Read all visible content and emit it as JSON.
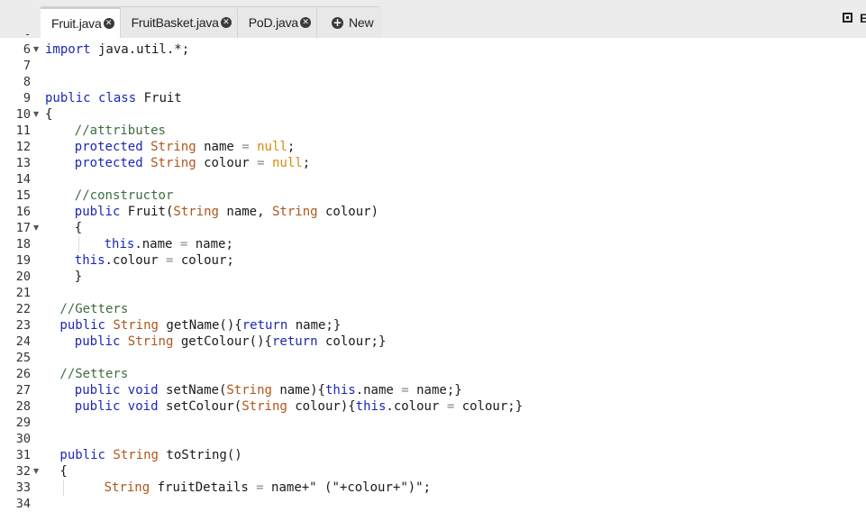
{
  "tabs": [
    {
      "label": "Fruit.java",
      "active": true
    },
    {
      "label": "FruitBasket.java",
      "active": false
    },
    {
      "label": "PoD.java",
      "active": false
    }
  ],
  "new_tab_label": "New",
  "edge_glyph": "E",
  "colors": {
    "keyword": "#1c27b8",
    "type": "#b0551b",
    "comment": "#3f6d3f",
    "literal": "#d88c0c",
    "tab_bar": "#ececec"
  },
  "editor": {
    "lines": [
      {
        "num": "6",
        "fold": true,
        "indent": 0,
        "code": [
          [
            "kw",
            "import"
          ],
          [
            "",
            "java.util.*;"
          ]
        ]
      },
      {
        "num": "7",
        "fold": false,
        "indent": 0,
        "code": []
      },
      {
        "num": "8",
        "fold": false,
        "indent": 0,
        "code": []
      },
      {
        "num": "9",
        "fold": false,
        "indent": 0,
        "code": [
          [
            "kw",
            "public class"
          ],
          [
            "",
            "Fruit"
          ]
        ]
      },
      {
        "num": "10",
        "fold": true,
        "indent": 0,
        "code": [
          [
            "",
            "{"
          ]
        ]
      },
      {
        "num": "11",
        "fold": false,
        "indent": 4,
        "code": [
          [
            "cm",
            "//attributes"
          ]
        ]
      },
      {
        "num": "12",
        "fold": false,
        "indent": 4,
        "code": [
          [
            "kw",
            "protected"
          ],
          [
            "ty",
            "String"
          ],
          [
            "",
            "name"
          ],
          [
            "op",
            "="
          ],
          [
            "nu",
            "null"
          ],
          [
            "",
            ";"
          ]
        ]
      },
      {
        "num": "13",
        "fold": false,
        "indent": 4,
        "code": [
          [
            "kw",
            "protected"
          ],
          [
            "ty",
            "String"
          ],
          [
            "",
            "colour"
          ],
          [
            "op",
            "="
          ],
          [
            "nu",
            "null"
          ],
          [
            "",
            ";"
          ]
        ]
      },
      {
        "num": "14",
        "fold": false,
        "indent": 0,
        "code": []
      },
      {
        "num": "15",
        "fold": false,
        "indent": 4,
        "code": [
          [
            "cm",
            "//constructor"
          ]
        ]
      },
      {
        "num": "16",
        "fold": false,
        "indent": 4,
        "code": [
          [
            "kw",
            "public"
          ],
          [
            "",
            "Fruit("
          ],
          [
            "ty",
            "String"
          ],
          [
            "",
            "name,"
          ],
          [
            "ty",
            "String"
          ],
          [
            "",
            "colour)"
          ]
        ]
      },
      {
        "num": "17",
        "fold": true,
        "indent": 4,
        "code": [
          [
            "",
            "{"
          ]
        ]
      },
      {
        "num": "18",
        "fold": false,
        "indent": 8,
        "code": [
          [
            "kw",
            "this"
          ],
          [
            "",
            ".name"
          ],
          [
            "op",
            "="
          ],
          [
            "",
            "name;"
          ]
        ]
      },
      {
        "num": "19",
        "fold": false,
        "indent": 4,
        "code": [
          [
            "kw",
            "this"
          ],
          [
            "",
            ".colour"
          ],
          [
            "op",
            "="
          ],
          [
            "",
            "colour;"
          ]
        ]
      },
      {
        "num": "20",
        "fold": false,
        "indent": 4,
        "code": [
          [
            "",
            "}"
          ]
        ]
      },
      {
        "num": "21",
        "fold": false,
        "indent": 0,
        "code": []
      },
      {
        "num": "22",
        "fold": false,
        "indent": 2,
        "code": [
          [
            "cm",
            "//Getters"
          ]
        ]
      },
      {
        "num": "23",
        "fold": false,
        "indent": 2,
        "code": [
          [
            "kw",
            "public"
          ],
          [
            "ty",
            "String"
          ],
          [
            "",
            "getName(){"
          ],
          [
            "kw",
            "return"
          ],
          [
            "",
            "name;}"
          ]
        ]
      },
      {
        "num": "24",
        "fold": false,
        "indent": 4,
        "code": [
          [
            "kw",
            "public"
          ],
          [
            "ty",
            "String"
          ],
          [
            "",
            "getColour(){"
          ],
          [
            "kw",
            "return"
          ],
          [
            "",
            "colour;}"
          ]
        ]
      },
      {
        "num": "25",
        "fold": false,
        "indent": 0,
        "code": []
      },
      {
        "num": "26",
        "fold": false,
        "indent": 2,
        "code": [
          [
            "cm",
            "//Setters"
          ]
        ]
      },
      {
        "num": "27",
        "fold": false,
        "indent": 4,
        "code": [
          [
            "kw",
            "public void"
          ],
          [
            "",
            "setName("
          ],
          [
            "ty",
            "String"
          ],
          [
            "",
            "name){"
          ],
          [
            "kw",
            "this"
          ],
          [
            "",
            ".name"
          ],
          [
            "op",
            "="
          ],
          [
            "",
            "name;}"
          ]
        ]
      },
      {
        "num": "28",
        "fold": false,
        "indent": 4,
        "code": [
          [
            "kw",
            "public void"
          ],
          [
            "",
            "setColour("
          ],
          [
            "ty",
            "String"
          ],
          [
            "",
            "colour){"
          ],
          [
            "kw",
            "this"
          ],
          [
            "",
            ".colour"
          ],
          [
            "op",
            "="
          ],
          [
            "",
            "colour;}"
          ]
        ]
      },
      {
        "num": "29",
        "fold": false,
        "indent": 0,
        "code": []
      },
      {
        "num": "30",
        "fold": false,
        "indent": 0,
        "code": []
      },
      {
        "num": "31",
        "fold": false,
        "indent": 2,
        "code": [
          [
            "kw",
            "public"
          ],
          [
            "ty",
            "String"
          ],
          [
            "",
            "toString()"
          ]
        ]
      },
      {
        "num": "32",
        "fold": true,
        "indent": 2,
        "code": [
          [
            "",
            "{"
          ]
        ]
      },
      {
        "num": "33",
        "fold": false,
        "indent": 8,
        "code": [
          [
            "ty",
            "String"
          ],
          [
            "",
            "fruitDetails"
          ],
          [
            "op",
            "="
          ],
          [
            "",
            "name+\" (\"+colour+\")\";"
          ]
        ]
      },
      {
        "num": "34",
        "fold": false,
        "indent": 0,
        "code": []
      }
    ]
  }
}
